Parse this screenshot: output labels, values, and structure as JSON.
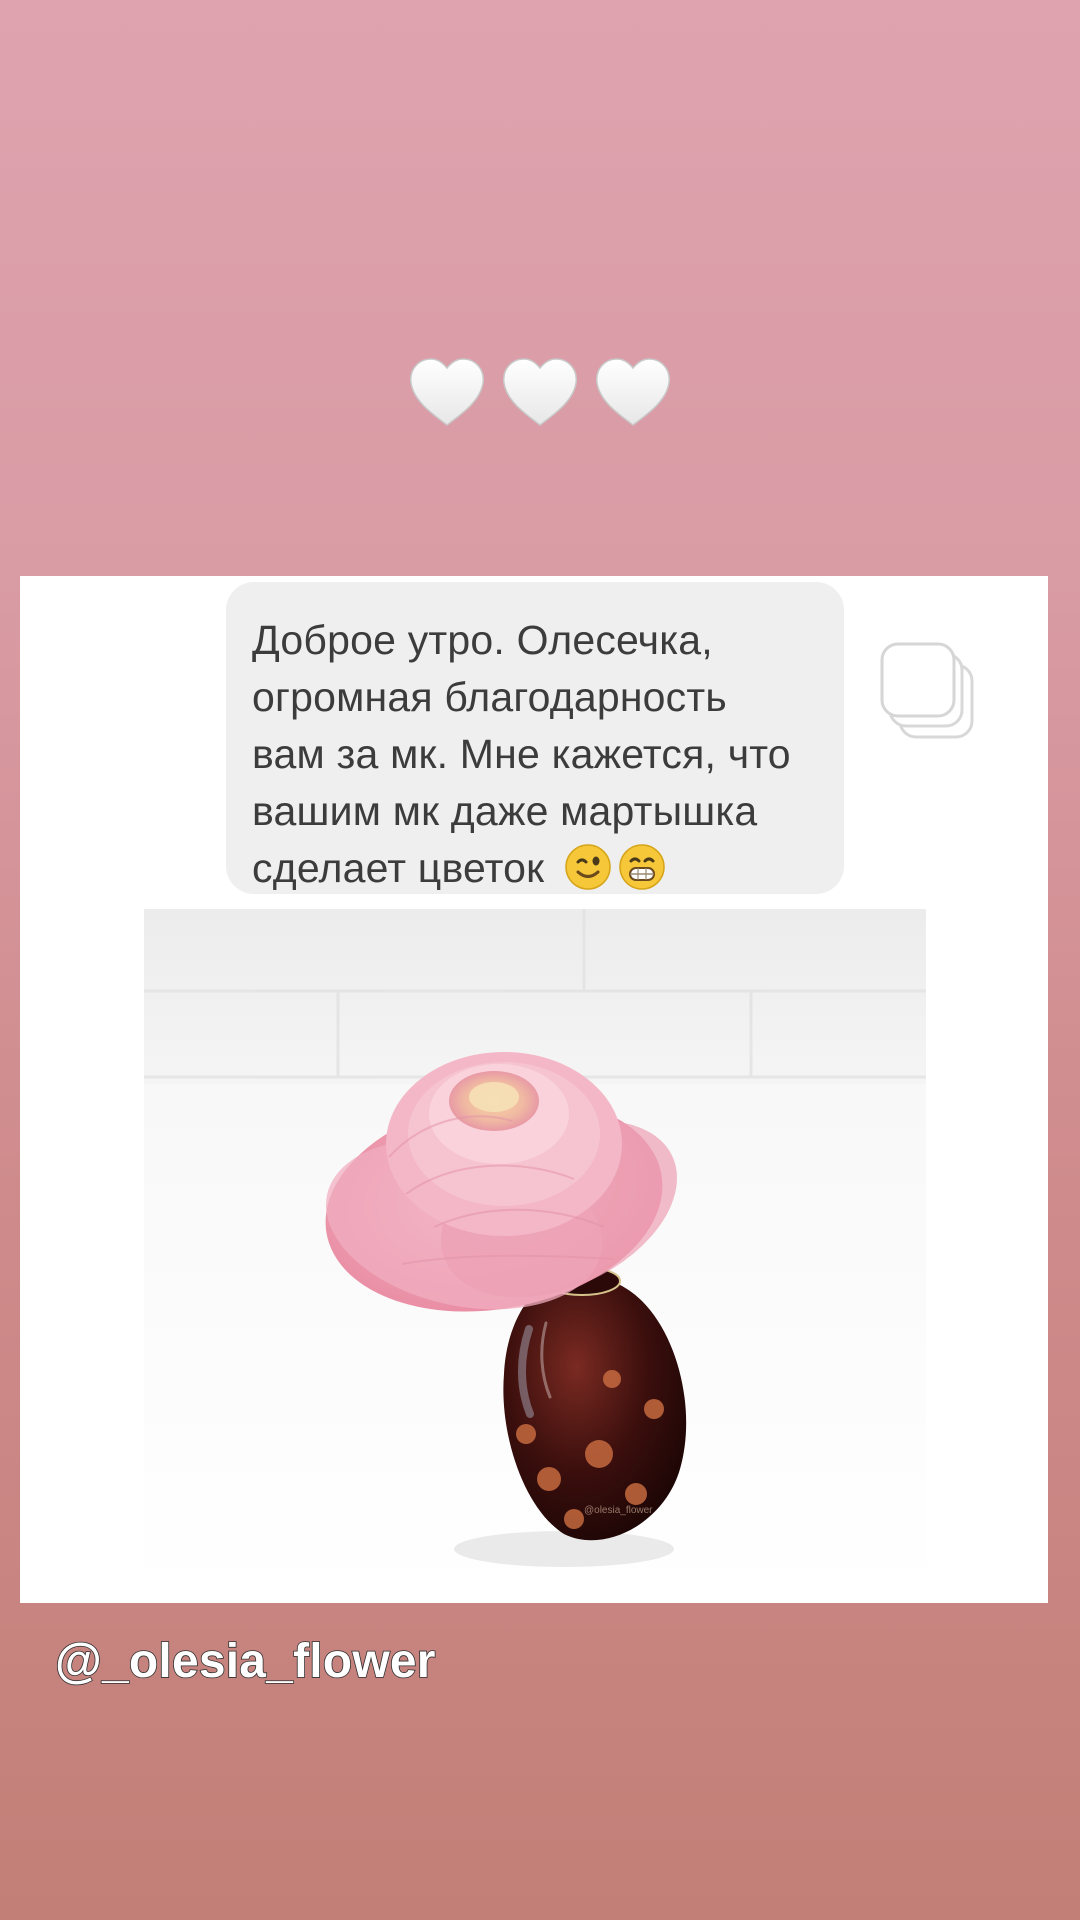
{
  "story": {
    "hearts": [
      "white-heart-icon",
      "white-heart-icon",
      "white-heart-icon"
    ]
  },
  "message": {
    "lines": [
      "Доброе утро. Олесечка,",
      "огромная благодарность",
      "вам за мк. Мне кажется, что",
      "вашим мк даже мартышка",
      "сделает цветок"
    ],
    "emojis": [
      "wink-emoji-icon",
      "grin-emoji-icon"
    ]
  },
  "attribution": {
    "handle": "@_olesia_flower"
  },
  "colors": {
    "background_top": "#dea3af",
    "background_bottom": "#c27f77",
    "card": "#ffffff",
    "bubble": "#efefef",
    "text": "#3c3c3c"
  }
}
